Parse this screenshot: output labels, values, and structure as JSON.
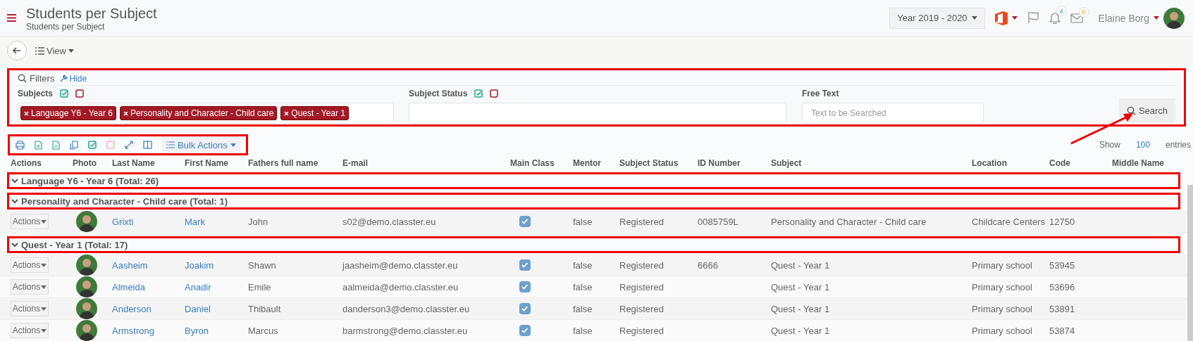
{
  "header": {
    "title": "Students per Subject",
    "subtitle": "Students per Subject",
    "year": "Year 2019 - 2020",
    "notifications": "4",
    "messages": "0",
    "user": "Elaine Borg"
  },
  "toolbar": {
    "view": "View"
  },
  "filters": {
    "title": "Filters",
    "hide": "Hide",
    "fields": [
      {
        "kind": "tags",
        "label": "Subjects",
        "tags": [
          "Language Y6 - Year 6",
          "Personality and Character - Child care",
          "Quest - Year 1"
        ]
      },
      {
        "kind": "tags",
        "label": "Subject Status"
      },
      {
        "kind": "text",
        "label": "Free Text",
        "placeholder": "Text to be Searched"
      }
    ],
    "search": "Search"
  },
  "bulk": {
    "label": "Bulk Actions",
    "show": "Show",
    "count": "100",
    "entries": "entries"
  },
  "table": {
    "columns": [
      "Actions",
      "Photo",
      "Last Name",
      "First Name",
      "Fathers full name",
      "E-mail",
      "Main Class",
      "Mentor",
      "Subject Status",
      "ID Number",
      "Subject",
      "Location",
      "Code",
      "Middle Name"
    ],
    "groups": [
      {
        "label": "Language Y6 - Year 6 (Total: 26)",
        "expanded": true
      },
      {
        "label": "Personality and Character - Child care (Total: 1)",
        "expanded": true,
        "rows": [
          {
            "actions": "Actions",
            "last": "Grixti",
            "first": "Mark",
            "father": "John",
            "email": "s02@demo.classter.eu",
            "main_class": true,
            "mentor": "false",
            "status": "Registered",
            "id": "0085759L",
            "subject": "Personality and Character - Child care",
            "location": "Childcare Centers",
            "code": "12750"
          }
        ]
      },
      {
        "label": "Quest - Year 1 (Total: 17)",
        "expanded": true,
        "rows": [
          {
            "actions": "Actions",
            "last": "Aasheim",
            "first": "Joakim",
            "father": "Shawn",
            "email": "jaasheim@demo.classter.eu",
            "main_class": true,
            "mentor": "false",
            "status": "Registered",
            "id": "6666",
            "subject": "Quest - Year 1",
            "location": "Primary school",
            "code": "53945"
          },
          {
            "actions": "Actions",
            "last": "Almeida",
            "first": "Anadir",
            "father": "Emile",
            "email": "aalmeida@demo.classter.eu",
            "main_class": true,
            "mentor": "false",
            "status": "Registered",
            "subject": "Quest - Year 1",
            "location": "Primary school",
            "code": "53696"
          },
          {
            "actions": "Actions",
            "last": "Anderson",
            "first": "Daniel",
            "father": "Thibault",
            "email": "danderson3@demo.classter.eu",
            "main_class": true,
            "mentor": "false",
            "status": "Registered",
            "subject": "Quest - Year 1",
            "location": "Primary school",
            "code": "53891"
          },
          {
            "actions": "Actions",
            "last": "Armstrong",
            "first": "Byron",
            "father": "Marcus",
            "email": "barmstrong@demo.classter.eu",
            "main_class": true,
            "mentor": "false",
            "status": "Registered",
            "subject": "Quest - Year 1",
            "location": "Primary school",
            "code": "53874"
          }
        ]
      }
    ]
  }
}
